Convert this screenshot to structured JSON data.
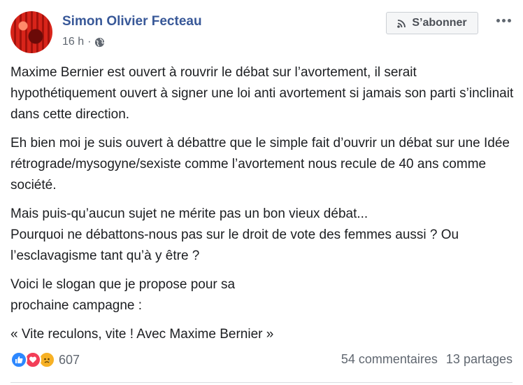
{
  "post": {
    "author": "Simon Olivier Fecteau",
    "time": "16 h",
    "time_separator": "·",
    "privacy_icon": "globe-icon",
    "follow_label": "S’abonner",
    "follow_icon": "rss-icon",
    "paragraphs": [
      "Maxime Bernier est ouvert à rouvrir le débat sur l’avortement, il serait hypothétiquement ouvert à signer une loi anti avortement si jamais son parti s’inclinait dans cette direction.",
      "Eh bien moi je suis ouvert à débattre que le simple fait d’ouvrir un débat sur une Idée rétrograde/mysogyne/sexiste comme l’avortement nous recule de 40 ans comme société.",
      "Mais puis-qu’aucun sujet ne mérite pas un bon vieux débat...\nPourquoi ne débattons-nous pas sur le droit de vote des femmes aussi ? Ou l’esclavagisme tant qu’à y être ?",
      "Voici le slogan que je propose pour sa\nprochaine campagne :",
      "« Vite reculons, vite ! Avec Maxime Bernier »"
    ]
  },
  "footer": {
    "reaction_icons": [
      "like-icon",
      "love-icon",
      "sad-icon"
    ],
    "reaction_count": "607",
    "comments": "54 commentaires",
    "shares": "13 partages"
  },
  "colors": {
    "author_blue": "#385898",
    "like_blue": "#2d88ff",
    "love_red": "#f33e58",
    "sad_yellow": "#f7b125",
    "meta_gray": "#606770"
  }
}
